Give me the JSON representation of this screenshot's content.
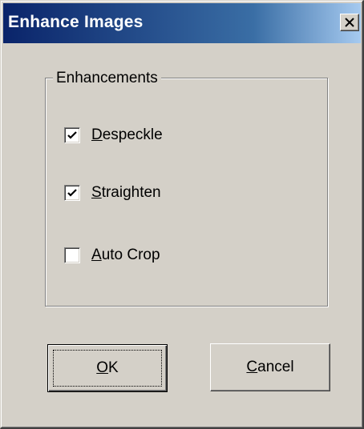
{
  "window": {
    "title": "Enhance Images",
    "close_icon": "close-x-icon"
  },
  "colors": {
    "titlebar_start": "#0a246a",
    "titlebar_end": "#a6caf0",
    "dialog_face": "#d4d0c8"
  },
  "enhancements": {
    "label": "Enhancements",
    "options": [
      {
        "mnemonic": "D",
        "rest": "especkle",
        "checked": true
      },
      {
        "mnemonic": "S",
        "rest": "traighten",
        "checked": true
      },
      {
        "mnemonic": "A",
        "rest": "uto Crop",
        "checked": false
      }
    ]
  },
  "buttons": {
    "ok": {
      "mnemonic": "O",
      "rest": "K",
      "default": true
    },
    "cancel": {
      "mnemonic": "C",
      "rest": "ancel"
    }
  }
}
